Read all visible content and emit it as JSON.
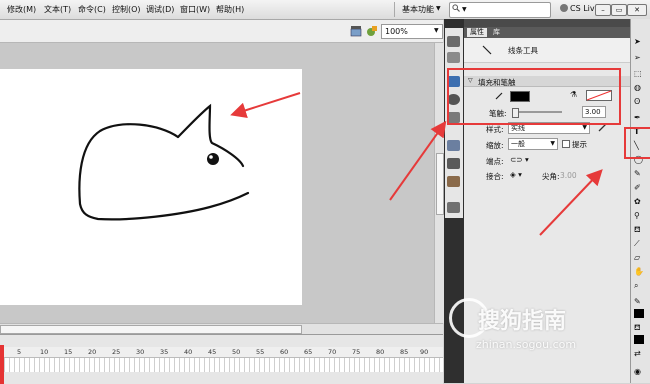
{
  "menu": {
    "items": [
      "修改(M)",
      "文本(T)",
      "命令(C)",
      "控制(O)",
      "调试(D)",
      "窗口(W)",
      "帮助(H)"
    ],
    "workspace": "基本功能",
    "cs_live": "CS Live"
  },
  "document": {
    "zoom": "100%"
  },
  "timeline": {
    "frame_numbers": [
      "5",
      "10",
      "15",
      "20",
      "25",
      "30",
      "35",
      "40",
      "45",
      "50",
      "55",
      "60",
      "65",
      "70",
      "75",
      "80",
      "85",
      "90"
    ]
  },
  "properties": {
    "tab_properties": "属性",
    "tab_library": "库",
    "tool_name": "线条工具",
    "section_fill_stroke": "填充和笔触",
    "stroke_label": "笔触:",
    "stroke_value": "3.00",
    "style_label": "样式:",
    "style_value": "实线",
    "scale_label": "缩放:",
    "scale_value": "一般",
    "hint_label": "提示",
    "cap_label": "端点:",
    "join_label": "接合:",
    "miter_label": "尖角:",
    "miter_value": "3.00"
  },
  "watermark": {
    "text": "搜狗指南",
    "url": "zhinan.sogou.com"
  },
  "colors": {
    "annotation_red": "#e63a3a",
    "stroke_color": "#000000"
  }
}
